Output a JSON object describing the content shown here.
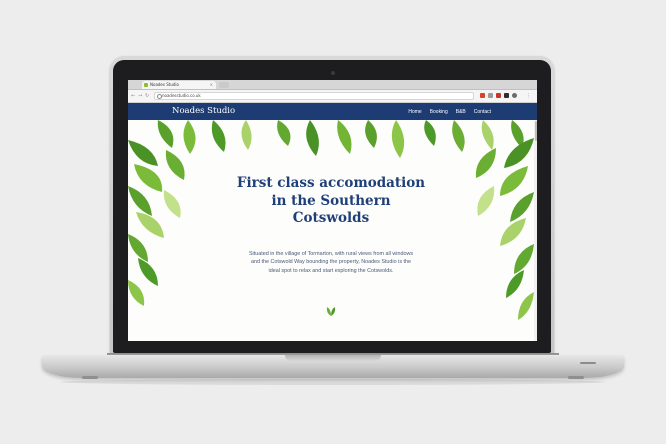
{
  "browser": {
    "tab_title": "Noades Studio",
    "tab_close": "×",
    "url": "noadesstudio.co.uk",
    "back": "←",
    "forward": "→",
    "reload": "↻"
  },
  "site": {
    "logo": "Noades Studio",
    "nav": [
      "Home",
      "Booking",
      "B&B",
      "Contact"
    ],
    "hero_title": "First class accomodation in the Southern Cotswolds",
    "hero_text": "Situated in the village of Tormarton, with rural views from all windows and the Cotswold Way bounding the property, Noades Studio is the ideal spot to relax and start exploring the Cotswolds."
  },
  "colors": {
    "brand_navy": "#1c3c73",
    "title_navy": "#1f3f78",
    "leaf_green": "#5aa02c",
    "leaf_light": "#a9d36a"
  },
  "icons": {
    "sprout": "sprout-icon",
    "lock": "lock-icon",
    "favicon": "leaf-favicon-icon"
  }
}
